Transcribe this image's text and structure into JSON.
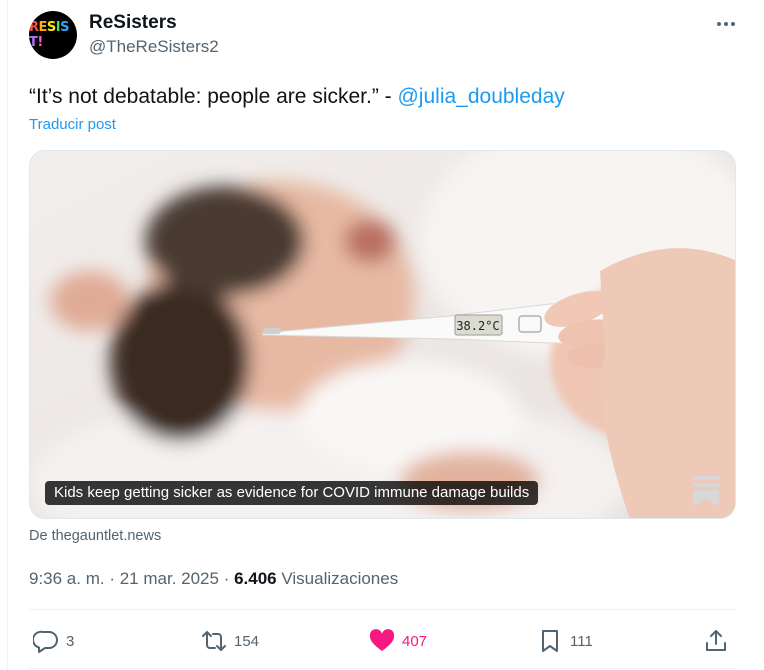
{
  "author": {
    "display_name": "ReSisters",
    "handle": "@TheReSisters2",
    "avatar_text": "RESIST!"
  },
  "tweet": {
    "text_prefix": "“It’s not debatable: people are sicker.” - ",
    "mention": "@julia_doubleday",
    "translate_label": "Traducir post"
  },
  "media": {
    "caption": "Kids keep getting sicker as evidence for COVID immune damage builds",
    "thermometer_reading": "38.2°C",
    "source": "De thegauntlet.news"
  },
  "meta": {
    "time": "9:36 a. m.",
    "sep1": " · ",
    "date": "21 mar. 2025",
    "sep2": " · ",
    "views_count": "6.406",
    "views_label": " Visualizaciones"
  },
  "actions": {
    "replies": "3",
    "reposts": "154",
    "likes": "407",
    "bookmarks": "111"
  },
  "colors": {
    "accent": "#1d9bf0",
    "like": "#f91880",
    "muted": "#536471"
  },
  "icons": [
    "more-icon",
    "reply-icon",
    "repost-icon",
    "heart-icon",
    "bookmark-icon",
    "share-icon",
    "bookmark-overlay-icon"
  ]
}
